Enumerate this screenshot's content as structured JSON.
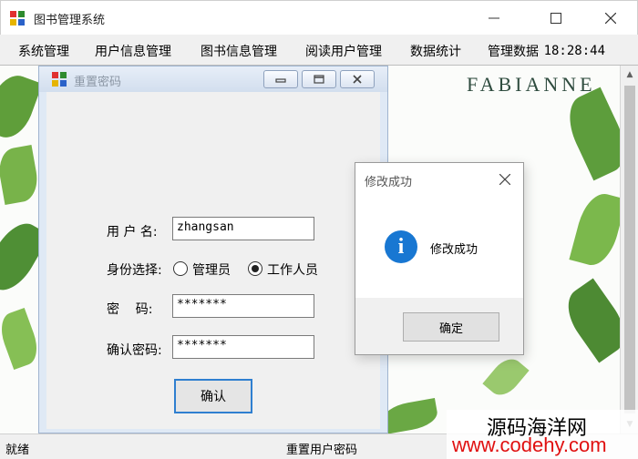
{
  "app": {
    "title": "图书管理系统"
  },
  "menu": [
    "系统管理",
    "用户信息管理",
    "图书信息管理",
    "阅读用户管理",
    "数据统计",
    "管理数据"
  ],
  "clock": "18:28:44",
  "background": {
    "brand": "FABIANNE"
  },
  "child_window": {
    "title": "重置密码",
    "form": {
      "username_label": "用 户 名:",
      "username_value": "zhangsan",
      "identity_label": "身份选择:",
      "radio_admin": "管理员",
      "radio_staff": "工作人员",
      "selected": "工作人员",
      "password_label": "密    码:",
      "password_value": "*******",
      "confirm_label": "确认密码:",
      "confirm_value": "*******",
      "submit": "确认"
    }
  },
  "dialog": {
    "title": "修改成功",
    "message": "修改成功",
    "ok": "确定"
  },
  "status": {
    "left": "就绪",
    "center": "重置用户密码"
  },
  "watermark": {
    "line1": "源码海洋网",
    "line2": "www.codehy.com"
  }
}
